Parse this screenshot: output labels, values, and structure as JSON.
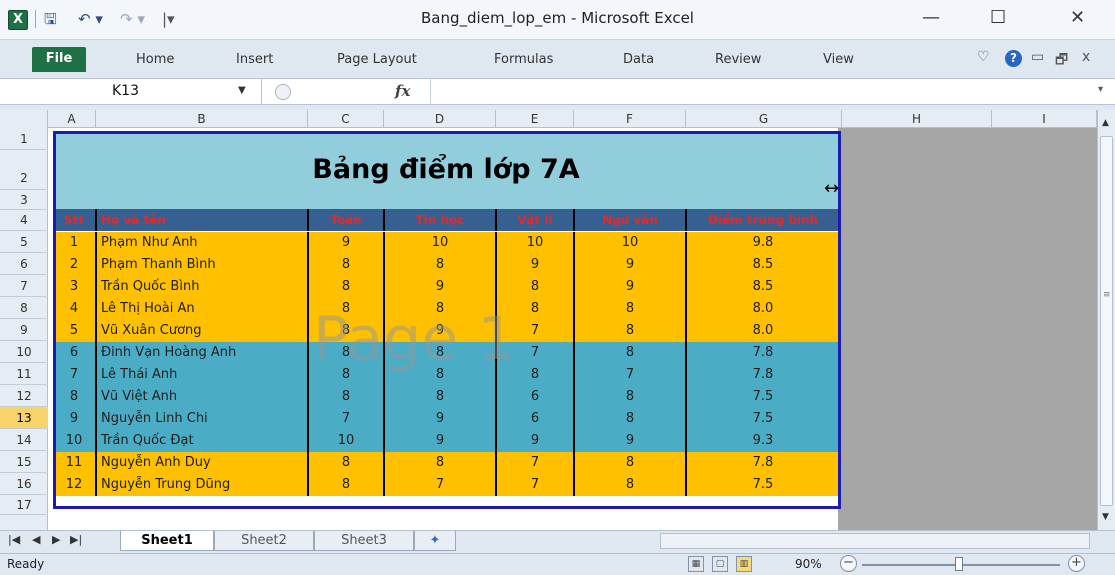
{
  "window": {
    "title": "Bang_diem_lop_em  -  Microsoft Excel",
    "app_icon": "X",
    "minimize": "—",
    "maximize": "☐",
    "close": "✕"
  },
  "quick_access": {
    "save": "🖫",
    "undo": "↶ ▾",
    "redo": "↷ ▾",
    "customize": "|▾"
  },
  "ribbon": {
    "file": "File",
    "tabs": [
      "Home",
      "Insert",
      "Page Layout",
      "Formulas",
      "Data",
      "Review",
      "View"
    ],
    "right_icons": [
      "♡",
      "?",
      "▭",
      "🗗",
      "ⅹ"
    ]
  },
  "formula_bar": {
    "name_box": "K13",
    "fx": "fx",
    "formula": ""
  },
  "columns": [
    "A",
    "B",
    "C",
    "D",
    "E",
    "F",
    "G",
    "H",
    "I"
  ],
  "rows": [
    "1",
    "2",
    "3",
    "4",
    "5",
    "6",
    "7",
    "8",
    "9",
    "10",
    "11",
    "12",
    "13",
    "14",
    "15",
    "16",
    "17"
  ],
  "selected_row": "13",
  "table": {
    "title": "Bảng điểm lớp 7A",
    "headers": [
      "Stt",
      "Họ và tên",
      "Toán",
      "Tin học",
      "Vật lí",
      "Ngữ văn",
      "Điểm trung bình"
    ],
    "rows": [
      [
        "1",
        "Phạm Như Anh",
        "9",
        "10",
        "10",
        "10",
        "9.8"
      ],
      [
        "2",
        "Phạm Thanh Bình",
        "8",
        "8",
        "9",
        "9",
        "8.5"
      ],
      [
        "3",
        "Trần Quốc Bình",
        "8",
        "9",
        "8",
        "9",
        "8.5"
      ],
      [
        "4",
        "Lê Thị Hoài An",
        "8",
        "8",
        "8",
        "8",
        "8.0"
      ],
      [
        "5",
        "Vũ Xuân Cương",
        "8",
        "9",
        "7",
        "8",
        "8.0"
      ],
      [
        "6",
        "Đinh Vạn Hoàng Anh",
        "8",
        "8",
        "7",
        "8",
        "7.8"
      ],
      [
        "7",
        "Lê Thái Anh",
        "8",
        "8",
        "8",
        "7",
        "7.8"
      ],
      [
        "8",
        "Vũ Việt Anh",
        "8",
        "8",
        "6",
        "8",
        "7.5"
      ],
      [
        "9",
        "Nguyễn Linh Chi",
        "7",
        "9",
        "6",
        "8",
        "7.5"
      ],
      [
        "10",
        "Trần Quốc Đạt",
        "10",
        "9",
        "9",
        "9",
        "9.3"
      ],
      [
        "11",
        "Nguyễn Anh Duy",
        "8",
        "8",
        "7",
        "8",
        "7.8"
      ],
      [
        "12",
        "Nguyễn Trung Dũng",
        "8",
        "7",
        "7",
        "8",
        "7.5"
      ]
    ],
    "row_colors": [
      "#ffc000",
      "#ffc000",
      "#ffc000",
      "#ffc000",
      "#ffc000",
      "#4bacc6",
      "#4bacc6",
      "#4bacc6",
      "#4bacc6",
      "#4bacc6",
      "#ffc000",
      "#ffc000"
    ]
  },
  "watermark": "Page 1",
  "sheets": [
    "Sheet1",
    "Sheet2",
    "Sheet3"
  ],
  "active_sheet": "Sheet1",
  "status": {
    "ready": "Ready",
    "zoom": "90%"
  },
  "colors": {
    "title_bg": "#92cddc",
    "header_bg": "#366092",
    "header_text": "#e82727",
    "border": "#1a1ab5",
    "file_tab": "#1e7145"
  }
}
